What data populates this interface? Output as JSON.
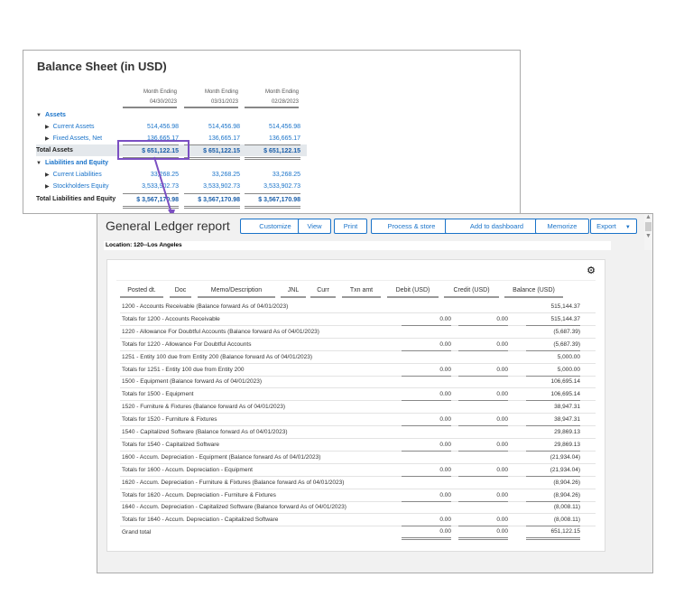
{
  "balance_sheet": {
    "title": "Balance Sheet (in USD)",
    "col_header": "Month Ending",
    "dates": [
      "04/30/2023",
      "03/31/2023",
      "02/28/2023"
    ],
    "rows": [
      {
        "label": "Assets",
        "type": "section",
        "values": []
      },
      {
        "label": "Current Assets",
        "type": "item",
        "values": [
          "514,456.98",
          "514,456.98",
          "514,456.98"
        ]
      },
      {
        "label": "Fixed Assets, Net",
        "type": "item",
        "values": [
          "136,665.17",
          "136,665.17",
          "136,665.17"
        ]
      },
      {
        "label": "Total Assets",
        "type": "total",
        "values": [
          "$ 651,122.15",
          "$ 651,122.15",
          "$ 651,122.15"
        ]
      },
      {
        "label": "Liabilities and Equity",
        "type": "section",
        "values": []
      },
      {
        "label": "Current Liabilities",
        "type": "item",
        "values": [
          "33,268.25",
          "33,268.25",
          "33,268.25"
        ]
      },
      {
        "label": "Stockholders Equity",
        "type": "item",
        "values": [
          "3,533,902.73",
          "3,533,902.73",
          "3,533,902.73"
        ]
      },
      {
        "label": "Total Liabilities and Equity",
        "type": "total2",
        "values": [
          "$ 3,567,170.98",
          "$ 3,567,170.98",
          "$ 3,567,170.98"
        ]
      }
    ]
  },
  "ledger": {
    "title": "General Ledger report",
    "buttons": [
      "Customize",
      "View",
      "Print",
      "Process & store",
      "Add to dashboard",
      "Memorize",
      "Export"
    ],
    "location": "Location: 120--Los Angeles",
    "columns": [
      "Posted dt.",
      "Doc",
      "Memo/Description",
      "JNL",
      "Curr",
      "Txn amt",
      "Debit (USD)",
      "Credit (USD)",
      "Balance (USD)"
    ],
    "rows": [
      {
        "desc": "1200 - Accounts Receivable (Balance forward As of 04/01/2023)",
        "debit": "",
        "credit": "",
        "balance": "515,144.37"
      },
      {
        "desc": "Totals for 1200 - Accounts Receivable",
        "debit": "0.00",
        "credit": "0.00",
        "balance": "515,144.37"
      },
      {
        "desc": "1220 - Allowance For Doubtful Accounts (Balance forward As of 04/01/2023)",
        "debit": "",
        "credit": "",
        "balance": "(5,687.39)"
      },
      {
        "desc": "Totals for 1220 - Allowance For Doubtful Accounts",
        "debit": "0.00",
        "credit": "0.00",
        "balance": "(5,687.39)"
      },
      {
        "desc": "1251 - Entity 100 due from Entity 200 (Balance forward As of 04/01/2023)",
        "debit": "",
        "credit": "",
        "balance": "5,000.00"
      },
      {
        "desc": "Totals for 1251 - Entity 100 due from Entity 200",
        "debit": "0.00",
        "credit": "0.00",
        "balance": "5,000.00"
      },
      {
        "desc": "1500 - Equipment (Balance forward As of 04/01/2023)",
        "debit": "",
        "credit": "",
        "balance": "106,695.14"
      },
      {
        "desc": "Totals for 1500 - Equipment",
        "debit": "0.00",
        "credit": "0.00",
        "balance": "106,695.14"
      },
      {
        "desc": "1520 - Furniture & Fixtures (Balance forward As of 04/01/2023)",
        "debit": "",
        "credit": "",
        "balance": "38,947.31"
      },
      {
        "desc": "Totals for 1520 - Furniture & Fixtures",
        "debit": "0.00",
        "credit": "0.00",
        "balance": "38,947.31"
      },
      {
        "desc": "1540 - Capitalized Software (Balance forward As of 04/01/2023)",
        "debit": "",
        "credit": "",
        "balance": "29,869.13"
      },
      {
        "desc": "Totals for 1540 - Capitalized Software",
        "debit": "0.00",
        "credit": "0.00",
        "balance": "29,869.13"
      },
      {
        "desc": "1600 - Accum. Depreciation - Equipment (Balance forward As of 04/01/2023)",
        "debit": "",
        "credit": "",
        "balance": "(21,934.04)"
      },
      {
        "desc": "Totals for 1600 - Accum. Depreciation - Equipment",
        "debit": "0.00",
        "credit": "0.00",
        "balance": "(21,934.04)"
      },
      {
        "desc": "1620 - Accum. Depreciation - Furniture & Fixtures (Balance forward As of 04/01/2023)",
        "debit": "",
        "credit": "",
        "balance": "(8,904.26)"
      },
      {
        "desc": "Totals for 1620 - Accum. Depreciation - Furniture & Fixtures",
        "debit": "0.00",
        "credit": "0.00",
        "balance": "(8,904.26)"
      },
      {
        "desc": "1640 - Accum. Depreciation - Capitalized Software (Balance forward As of 04/01/2023)",
        "debit": "",
        "credit": "",
        "balance": "(8,008.11)"
      },
      {
        "desc": "Totals for 1640 - Accum. Depreciation - Capitalized Software",
        "debit": "0.00",
        "credit": "0.00",
        "balance": "(8,008.11)"
      },
      {
        "desc": "Grand total",
        "debit": "0.00",
        "credit": "0.00",
        "balance": "651,122.15"
      }
    ]
  }
}
